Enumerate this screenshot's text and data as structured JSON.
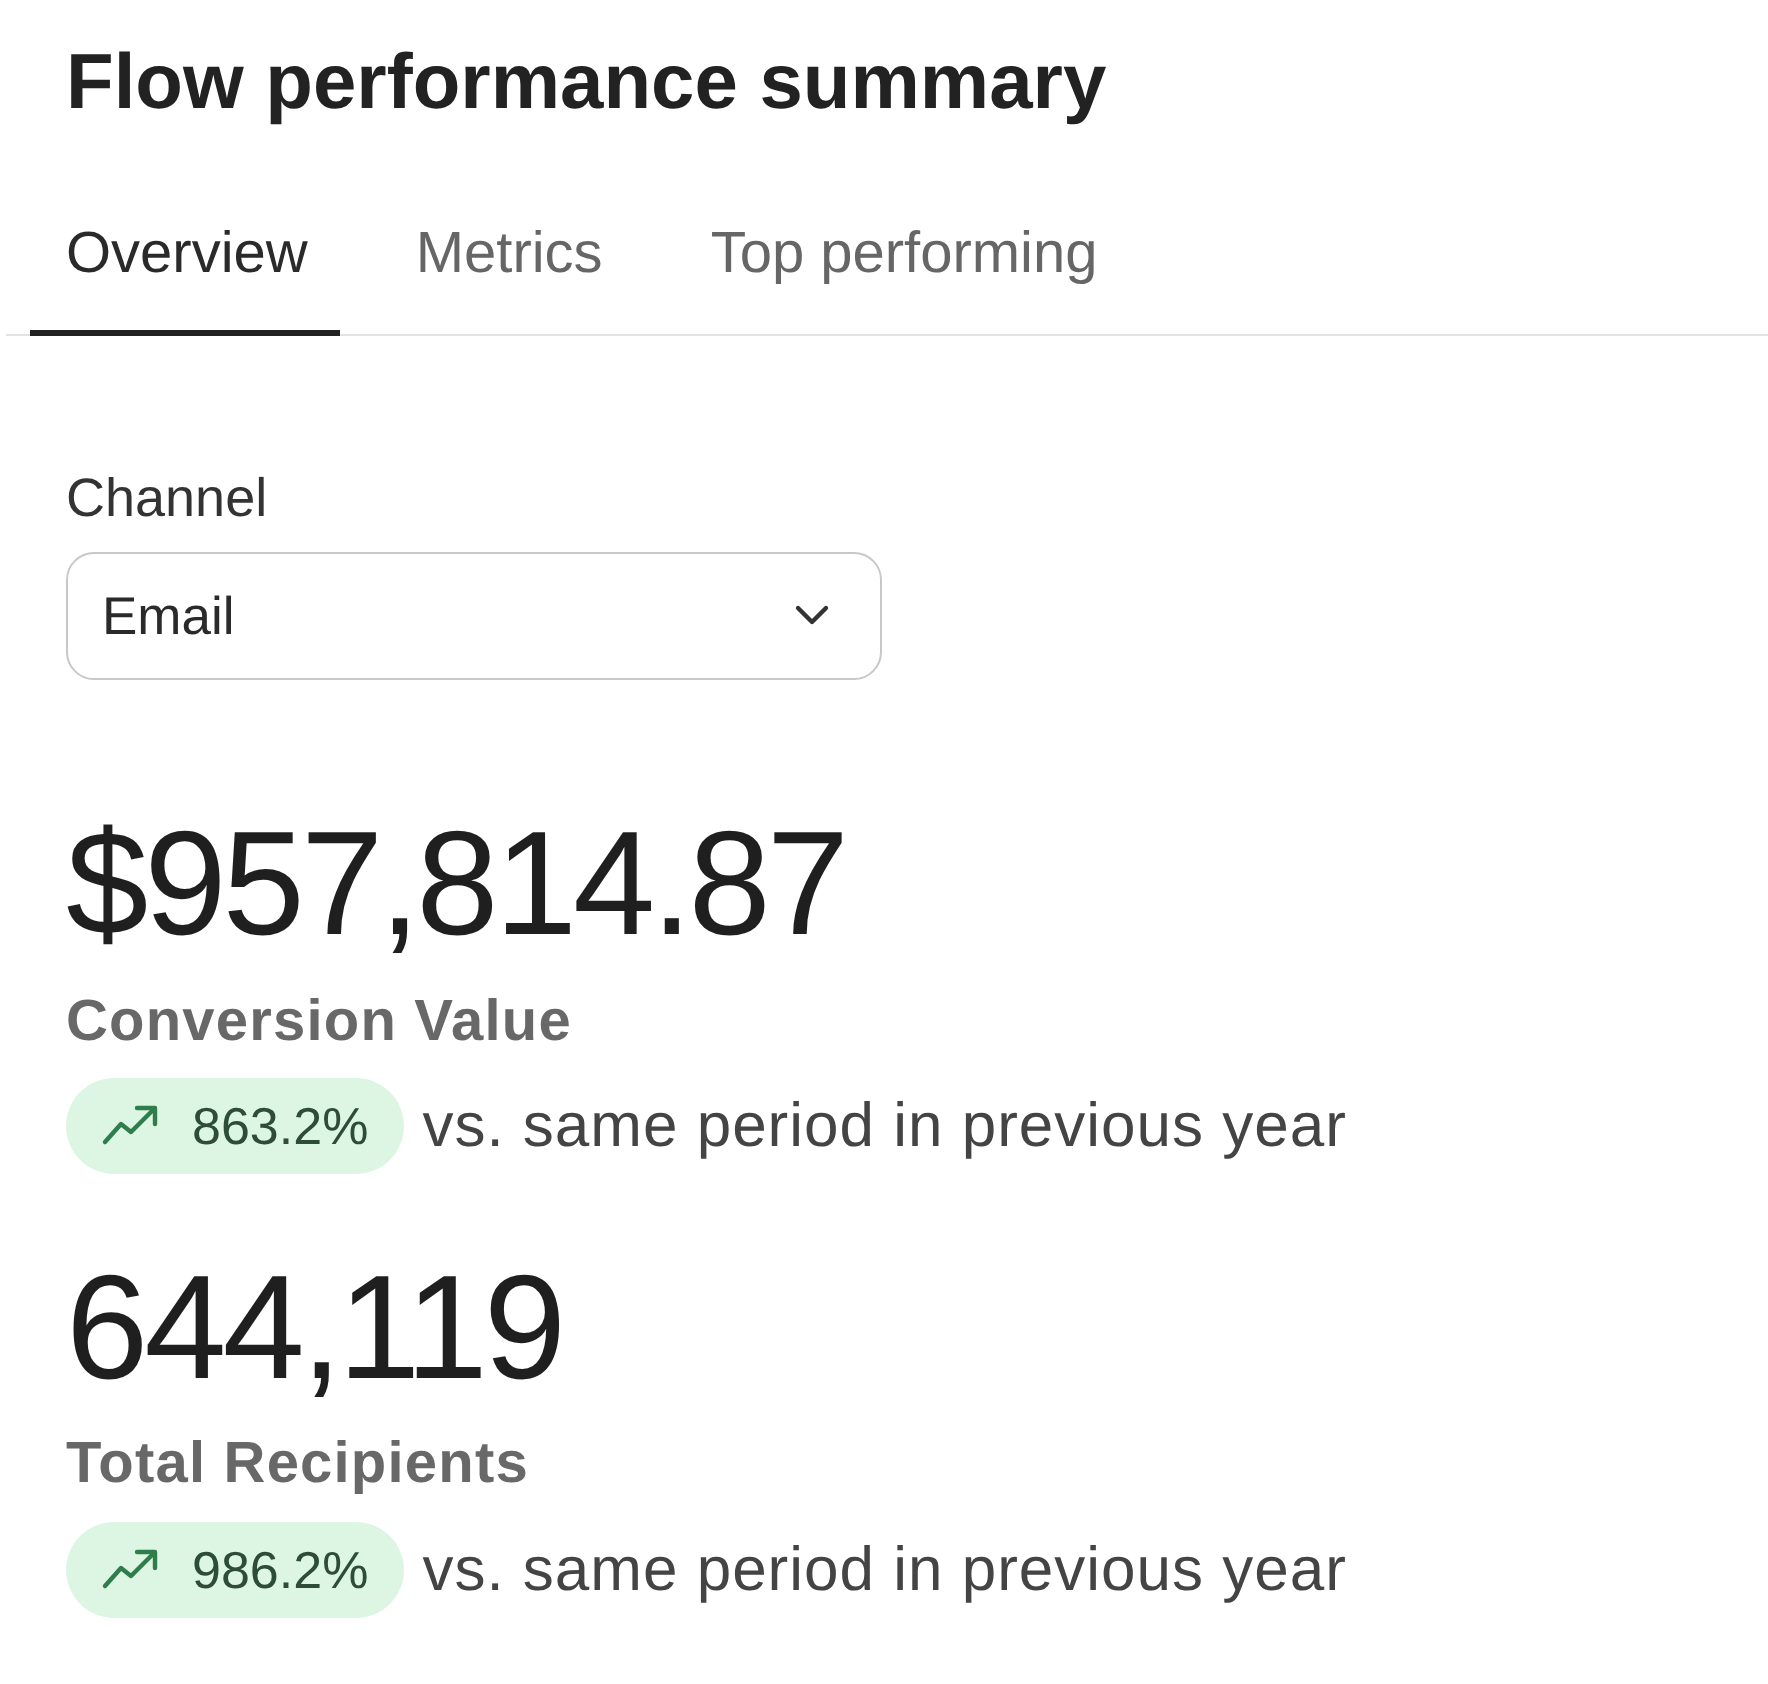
{
  "title": "Flow performance summary",
  "tabs": [
    {
      "label": "Overview",
      "selected": true
    },
    {
      "label": "Metrics",
      "selected": false
    },
    {
      "label": "Top performing",
      "selected": false
    }
  ],
  "channel_select": {
    "label": "Channel",
    "value": "Email"
  },
  "metrics": [
    {
      "value": "$957,814.87",
      "label": "Conversion Value",
      "kind": "increase",
      "change": "863.2%",
      "comparison": "vs. same period in previous year"
    },
    {
      "value": "644,119",
      "label": "Total Recipients",
      "kind": "increase",
      "change": "986.2%",
      "comparison": "vs. same period in previous year"
    }
  ]
}
